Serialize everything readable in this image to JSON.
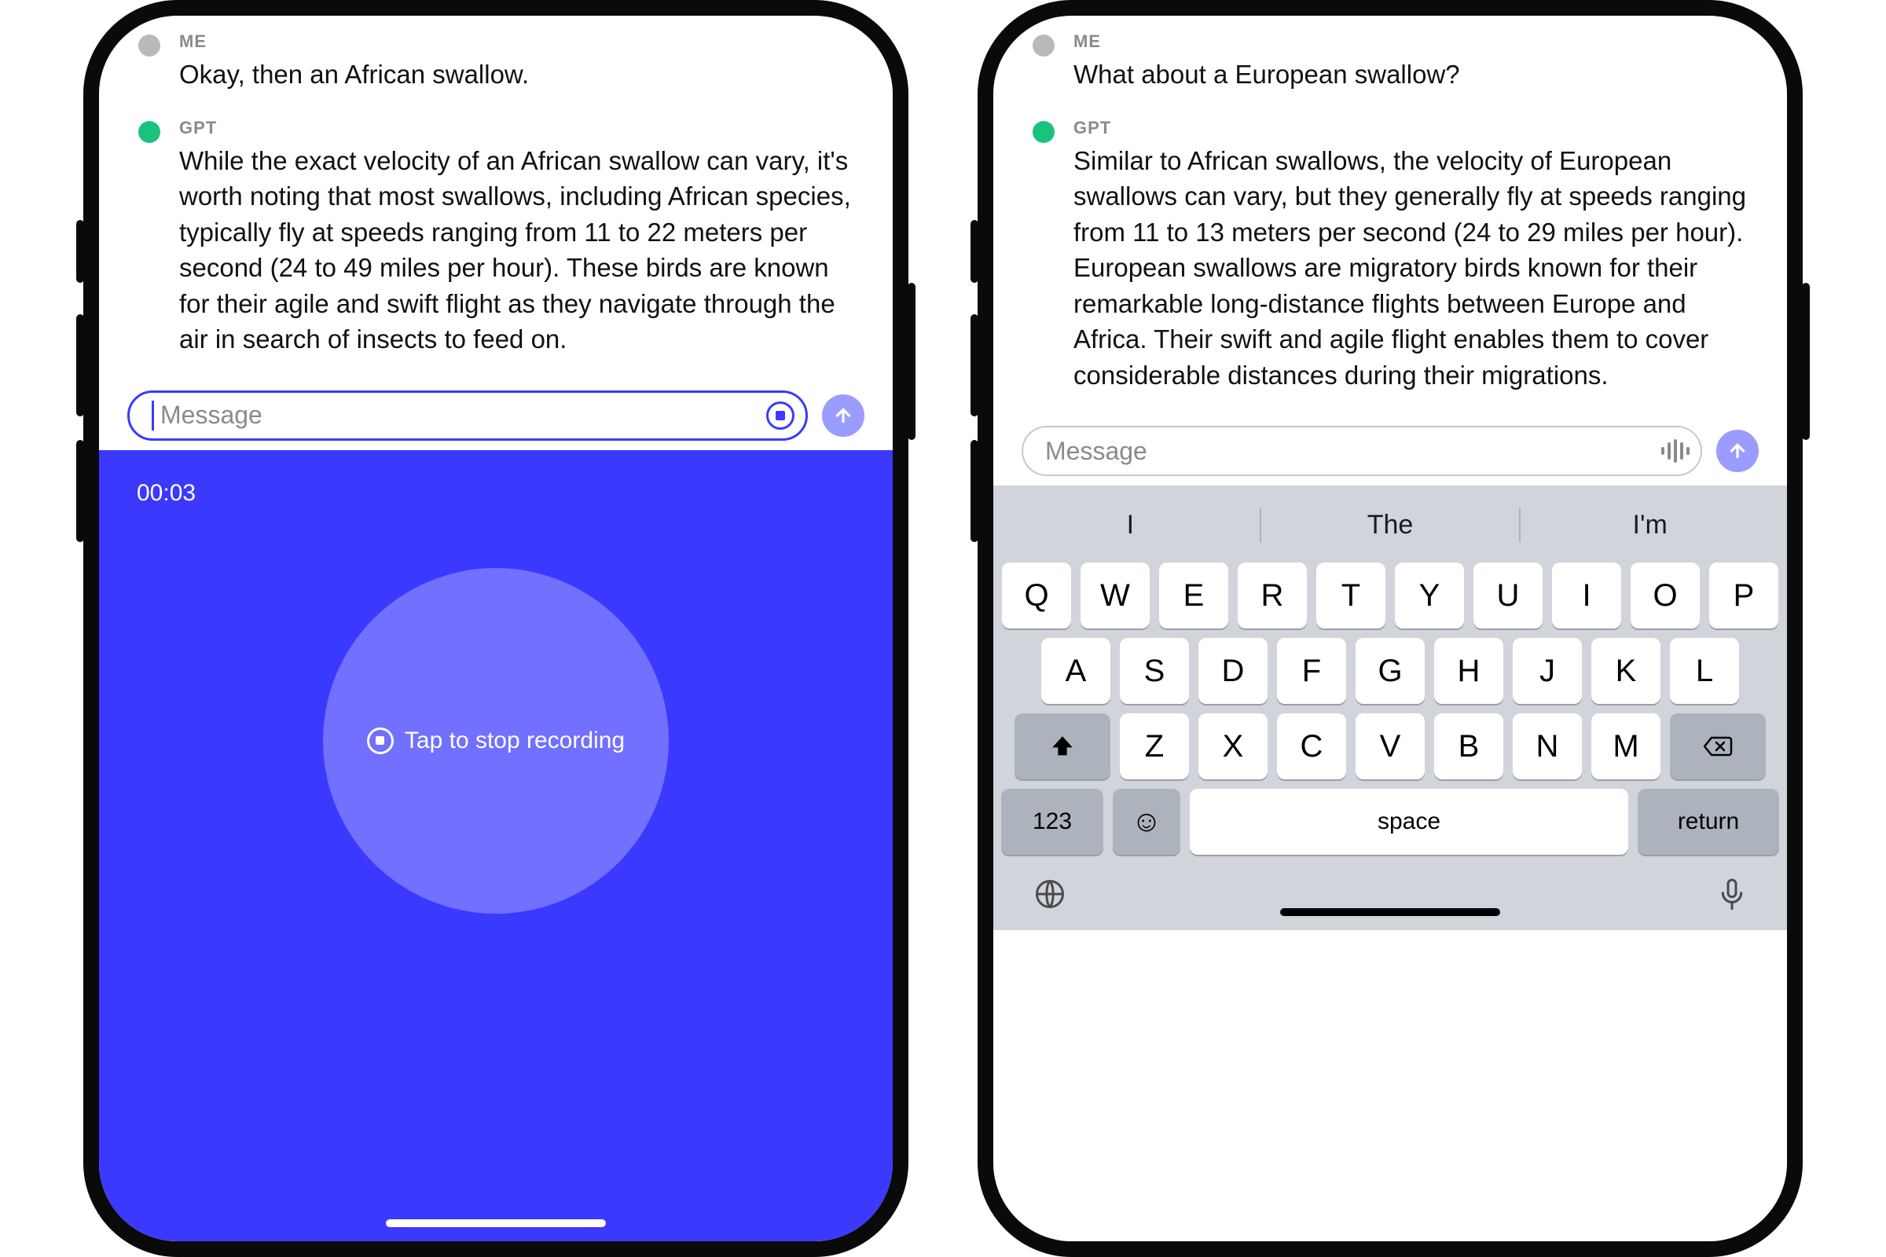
{
  "left": {
    "messages": {
      "me": {
        "role": "ME",
        "text": "Okay, then an African swallow."
      },
      "gpt": {
        "role": "GPT",
        "text": "While the exact velocity of an African swallow can vary, it's worth noting that most swallows, including African species, typically fly at speeds ranging from 11 to 22 meters per second (24 to 49 miles per hour). These birds are known for their agile and swift flight as they navigate through the air in search of insects to feed on."
      }
    },
    "composer": {
      "placeholder": "Message"
    },
    "recording": {
      "time": "00:03",
      "stop_label": "Tap to stop recording"
    }
  },
  "right": {
    "messages": {
      "me": {
        "role": "ME",
        "text": "What about a European swallow?"
      },
      "gpt": {
        "role": "GPT",
        "text": "Similar to African swallows, the velocity of European swallows can vary, but they generally fly at speeds ranging from 11 to 13 meters per second (24 to 29 miles per hour). European swallows are migratory birds known for their remarkable long-distance flights between Europe and Africa. Their swift and agile flight enables them to cover considerable distances during their migrations."
      }
    },
    "composer": {
      "placeholder": "Message"
    },
    "keyboard": {
      "predictions": [
        "I",
        "The",
        "I'm"
      ],
      "row1": [
        "Q",
        "W",
        "E",
        "R",
        "T",
        "Y",
        "U",
        "I",
        "O",
        "P"
      ],
      "row2": [
        "A",
        "S",
        "D",
        "F",
        "G",
        "H",
        "J",
        "K",
        "L"
      ],
      "row3": [
        "Z",
        "X",
        "C",
        "V",
        "B",
        "N",
        "M"
      ],
      "numeric": "123",
      "space": "space",
      "return": "return"
    }
  },
  "colors": {
    "accent": "#3b39ff",
    "send": "#9b9cff",
    "gpt": "#19c37d"
  }
}
